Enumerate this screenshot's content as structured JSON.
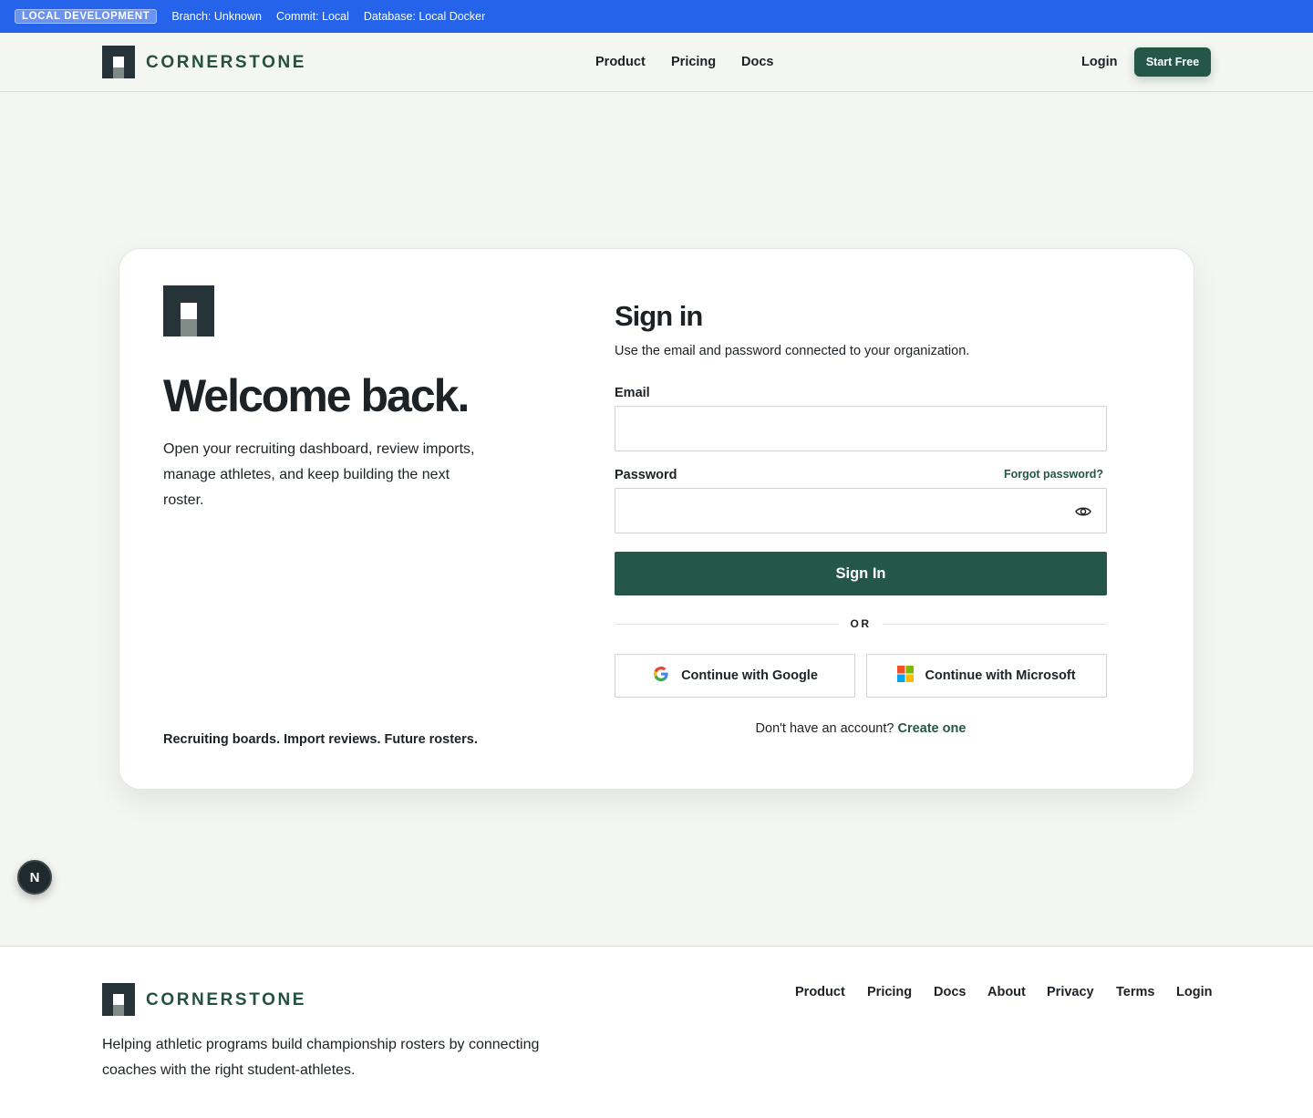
{
  "devbar": {
    "badge": "LOCAL DEVELOPMENT",
    "branch": "Branch: Unknown",
    "commit": "Commit: Local",
    "database": "Database: Local Docker",
    "color": "#2563eb"
  },
  "header": {
    "brand": "CORNERSTONE",
    "nav": [
      "Product",
      "Pricing",
      "Docs"
    ],
    "login": "Login",
    "start_free": "Start Free"
  },
  "intro": {
    "title": "Welcome back.",
    "description": "Open your recruiting dashboard, review imports, manage athletes, and keep building the next roster.",
    "tagline": "Recruiting boards. Import reviews. Future rosters."
  },
  "signin": {
    "title": "Sign in",
    "subtitle": "Use the email and password connected to your organization.",
    "email_label": "Email",
    "email_value": "",
    "password_label": "Password",
    "password_value": "",
    "forgot": "Forgot password?",
    "submit": "Sign In",
    "or": "OR",
    "google": "Continue with Google",
    "microsoft": "Continue with Microsoft",
    "no_account": "Don't have an account?",
    "create": "Create one"
  },
  "fab": {
    "label": "N"
  },
  "footer": {
    "brand": "CORNERSTONE",
    "description": "Helping athletic programs build championship rosters by connecting coaches with the right student-athletes.",
    "links": [
      "Product",
      "Pricing",
      "Docs",
      "About",
      "Privacy",
      "Terms",
      "Login"
    ]
  },
  "colors": {
    "brand_green": "#255748",
    "logo_dark": "#26343a",
    "background": "#f4f6f1"
  },
  "icons": [
    "eye-icon",
    "google-icon",
    "microsoft-icon"
  ]
}
